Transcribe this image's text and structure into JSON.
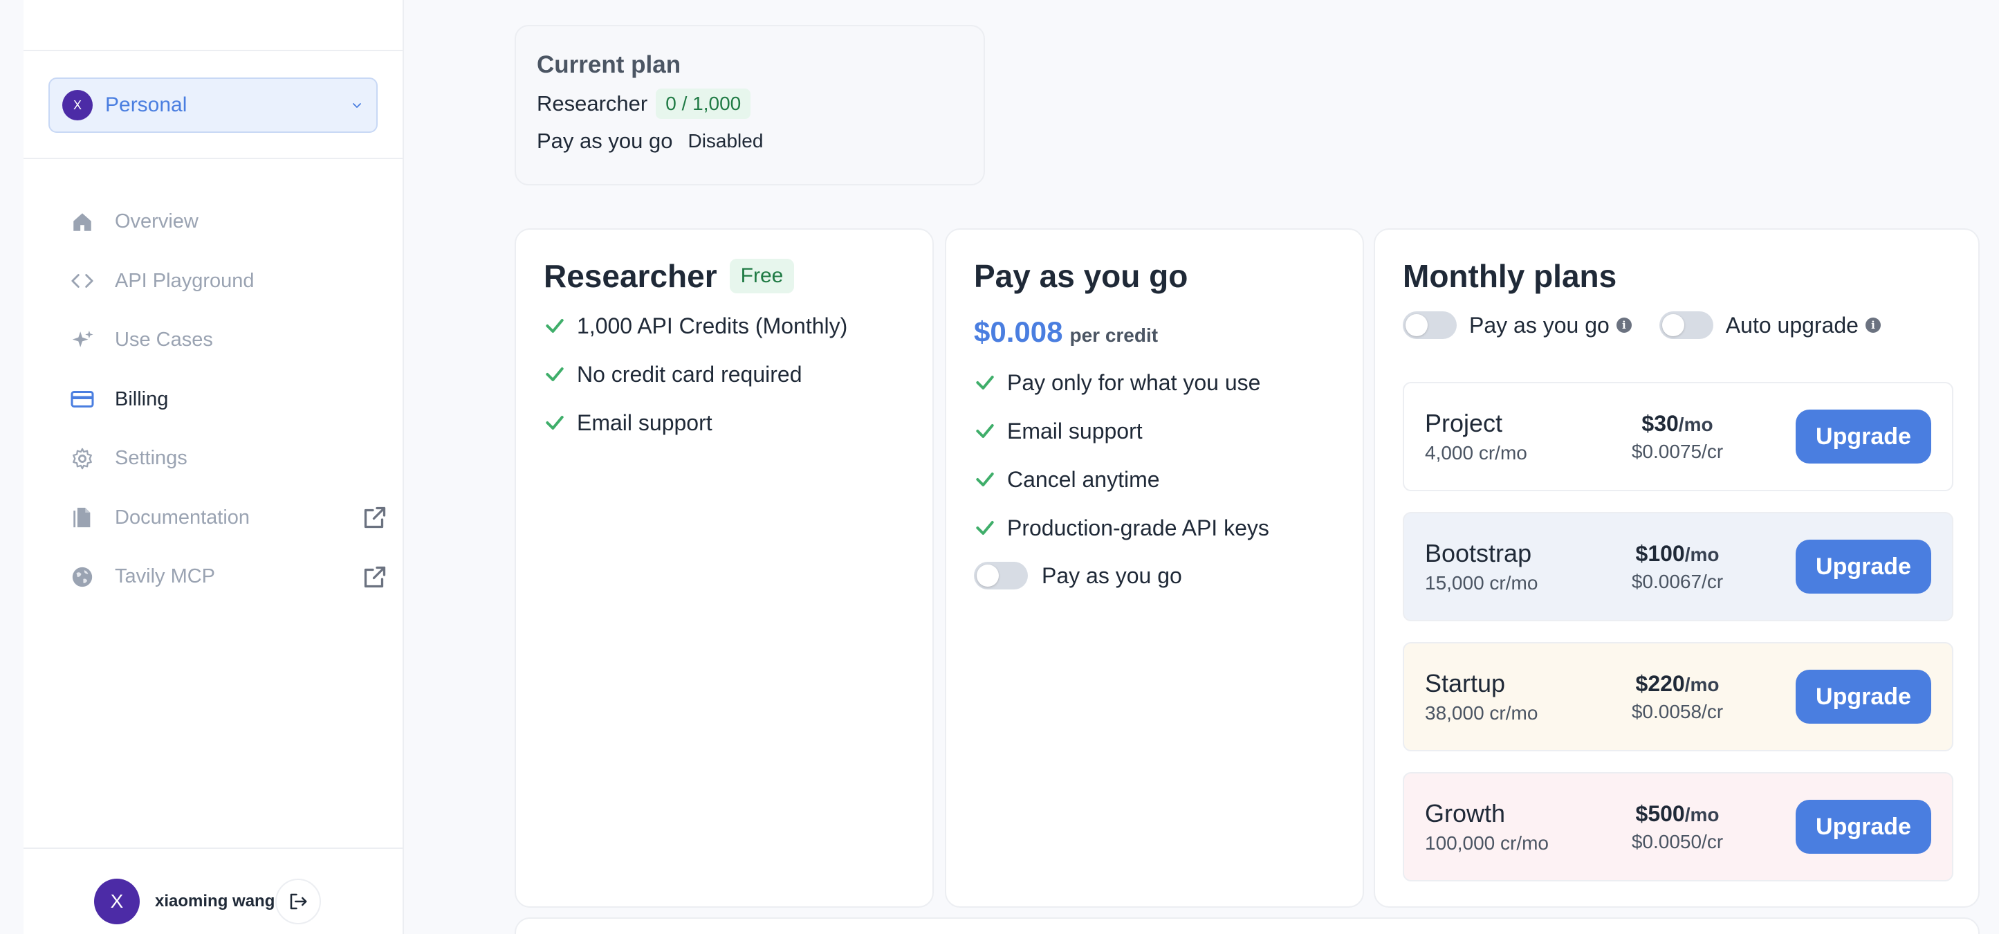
{
  "sidebar": {
    "workspace": {
      "avatar": "X",
      "label": "Personal"
    },
    "nav": [
      {
        "label": "Overview",
        "icon": "home-icon"
      },
      {
        "label": "API Playground",
        "icon": "code-icon"
      },
      {
        "label": "Use Cases",
        "icon": "sparkles-icon"
      },
      {
        "label": "Billing",
        "icon": "credit-card-icon",
        "active": true
      },
      {
        "label": "Settings",
        "icon": "gear-icon"
      },
      {
        "label": "Documentation",
        "icon": "document-icon",
        "external": true
      },
      {
        "label": "Tavily MCP",
        "icon": "globe-icon",
        "external": true
      }
    ],
    "user": {
      "avatar": "X",
      "name": "xiaoming wang"
    }
  },
  "current_plan": {
    "title": "Current plan",
    "plan_name": "Researcher",
    "usage": "0 / 1,000",
    "payg_label": "Pay as you go",
    "payg_status": "Disabled"
  },
  "researcher": {
    "title": "Researcher",
    "badge": "Free",
    "features": [
      "1,000 API Credits (Monthly)",
      "No credit card required",
      "Email support"
    ]
  },
  "payg": {
    "title": "Pay as you go",
    "price": "$0.008",
    "unit": "per credit",
    "features": [
      "Pay only for what you use",
      "Email support",
      "Cancel anytime",
      "Production-grade API keys"
    ],
    "toggle_label": "Pay as you go"
  },
  "monthly": {
    "title": "Monthly plans",
    "toggle_payg": "Pay as you go",
    "toggle_auto": "Auto upgrade",
    "plans": [
      {
        "name": "Project",
        "credits": "4,000 cr/mo",
        "price": "$30",
        "per": "/mo",
        "rate": "$0.0075/cr",
        "button": "Upgrade",
        "tint": "#ffffff"
      },
      {
        "name": "Bootstrap",
        "credits": "15,000 cr/mo",
        "price": "$100",
        "per": "/mo",
        "rate": "$0.0067/cr",
        "button": "Upgrade",
        "tint": "#eef2f9"
      },
      {
        "name": "Startup",
        "credits": "38,000 cr/mo",
        "price": "$220",
        "per": "/mo",
        "rate": "$0.0058/cr",
        "button": "Upgrade",
        "tint": "#fdf8ee"
      },
      {
        "name": "Growth",
        "credits": "100,000 cr/mo",
        "price": "$500",
        "per": "/mo",
        "rate": "$0.0050/cr",
        "button": "Upgrade",
        "tint": "#fdf2f4"
      }
    ]
  },
  "colors": {
    "accent": "#4a7ee0",
    "check": "#3fae6a",
    "avatar": "#4c2ba6"
  }
}
